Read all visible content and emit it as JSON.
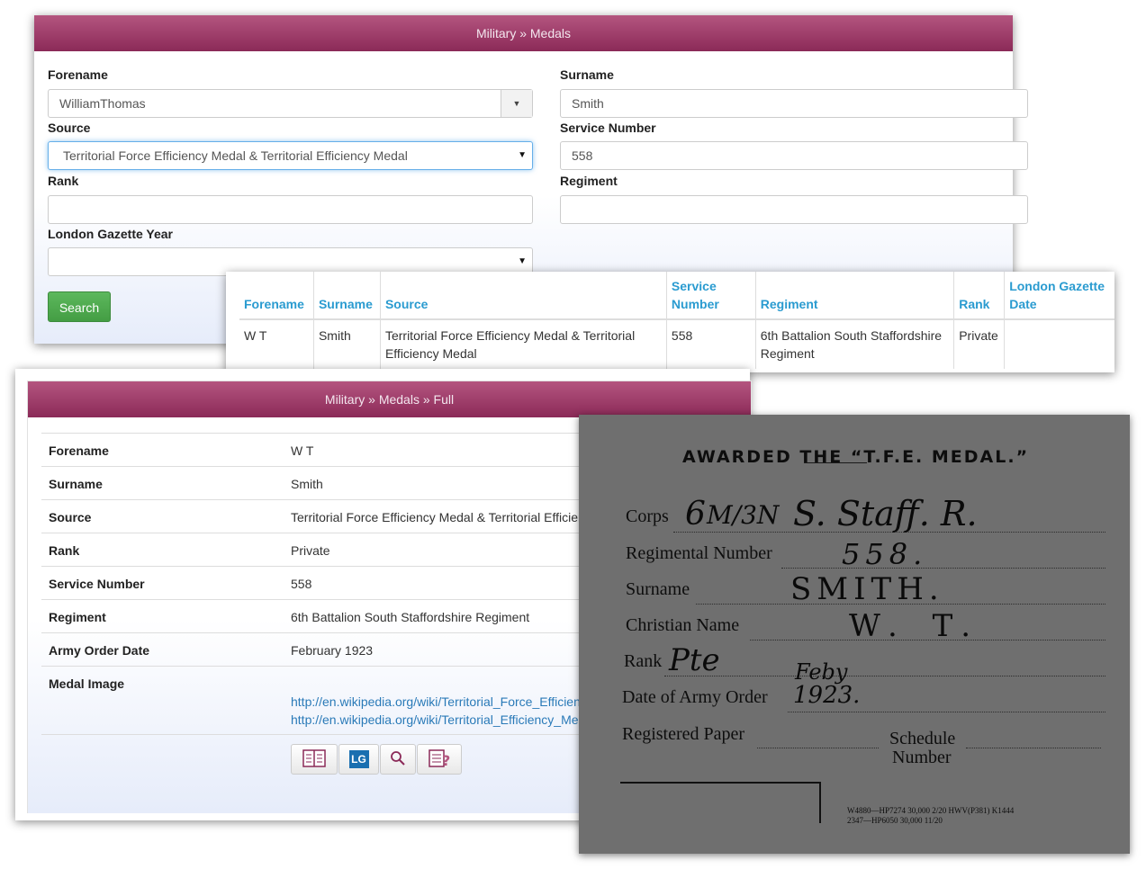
{
  "search_form": {
    "breadcrumb": "Military » Medals",
    "forename_label": "Forename",
    "forename_value": "WilliamThomas",
    "surname_label": "Surname",
    "surname_value": "Smith",
    "source_label": "Source",
    "source_value": "Territorial Force Efficiency Medal & Territorial Efficiency Medal",
    "service_number_label": "Service Number",
    "service_number_value": "558",
    "rank_label": "Rank",
    "rank_value": "",
    "regiment_label": "Regiment",
    "regiment_value": "",
    "gazette_year_label": "London Gazette Year",
    "gazette_year_value": "",
    "search_button": "Search"
  },
  "results": {
    "columns": [
      "Forename",
      "Surname",
      "Source",
      "Service Number",
      "Regiment",
      "Rank",
      "London Gazette Date"
    ],
    "rows": [
      {
        "forename": "W T",
        "surname": "Smith",
        "source": "Territorial Force Efficiency Medal & Territorial Efficiency Medal",
        "service_number": "558",
        "regiment": "6th Battalion South Staffordshire Regiment",
        "rank": "Private",
        "gazette_date": ""
      }
    ]
  },
  "detail": {
    "breadcrumb": "Military » Medals » Full",
    "rows": [
      {
        "label": "Forename",
        "value": "W T"
      },
      {
        "label": "Surname",
        "value": "Smith"
      },
      {
        "label": "Source",
        "value": "Territorial Force Efficiency Medal & Territorial Efficiency Medal"
      },
      {
        "label": "Rank",
        "value": "Private"
      },
      {
        "label": "Service Number",
        "value": "558"
      },
      {
        "label": "Regiment",
        "value": "6th Battalion South Staffordshire Regiment"
      },
      {
        "label": "Army Order Date",
        "value": "February 1923"
      },
      {
        "label": "Medal Image",
        "value": ""
      }
    ],
    "links": [
      "http://en.wikipedia.org/wiki/Territorial_Force_Efficiency_Medal",
      "http://en.wikipedia.org/wiki/Territorial_Efficiency_Medal"
    ],
    "action_icons": [
      "document-icon",
      "london-gazette-icon",
      "search-icon",
      "help-document-icon"
    ],
    "lg_icon_text": "LG"
  },
  "medal_card": {
    "heading": "AWARDED THE “T.F.E. MEDAL.”",
    "corps_label": "Corps",
    "corps_value": "6th Bn S. Staff. R.",
    "corps_hand_1": "6",
    "corps_hand_2": "M/3N",
    "corps_hand_3": "S. Staff. R.",
    "regimental_number_label": "Regimental Number",
    "regimental_number_value": "558.",
    "surname_label": "Surname",
    "surname_value": "SMITH.",
    "christian_name_label": "Christian Name",
    "christian_name_value": "W. T.",
    "rank_label": "Rank",
    "rank_value": "Pte",
    "army_order_label": "Date of Army Order",
    "army_order_value_month": "Feby",
    "army_order_value_year": "1923.",
    "registered_paper_label": "Registered Paper",
    "schedule_label_1": "Schedule",
    "schedule_label_2": "Number",
    "print_code_1": "W4880—HP7274  30,000  2/20  HWV(P381)  K1444",
    "print_code_2": "2347—HP6050  30,000  11/20"
  },
  "colors": {
    "header_top": "#b4557f",
    "header_bottom": "#8b2a58",
    "link": "#2a7ab8",
    "table_header": "#2a9bd0",
    "search_button": "#5cb85c"
  }
}
